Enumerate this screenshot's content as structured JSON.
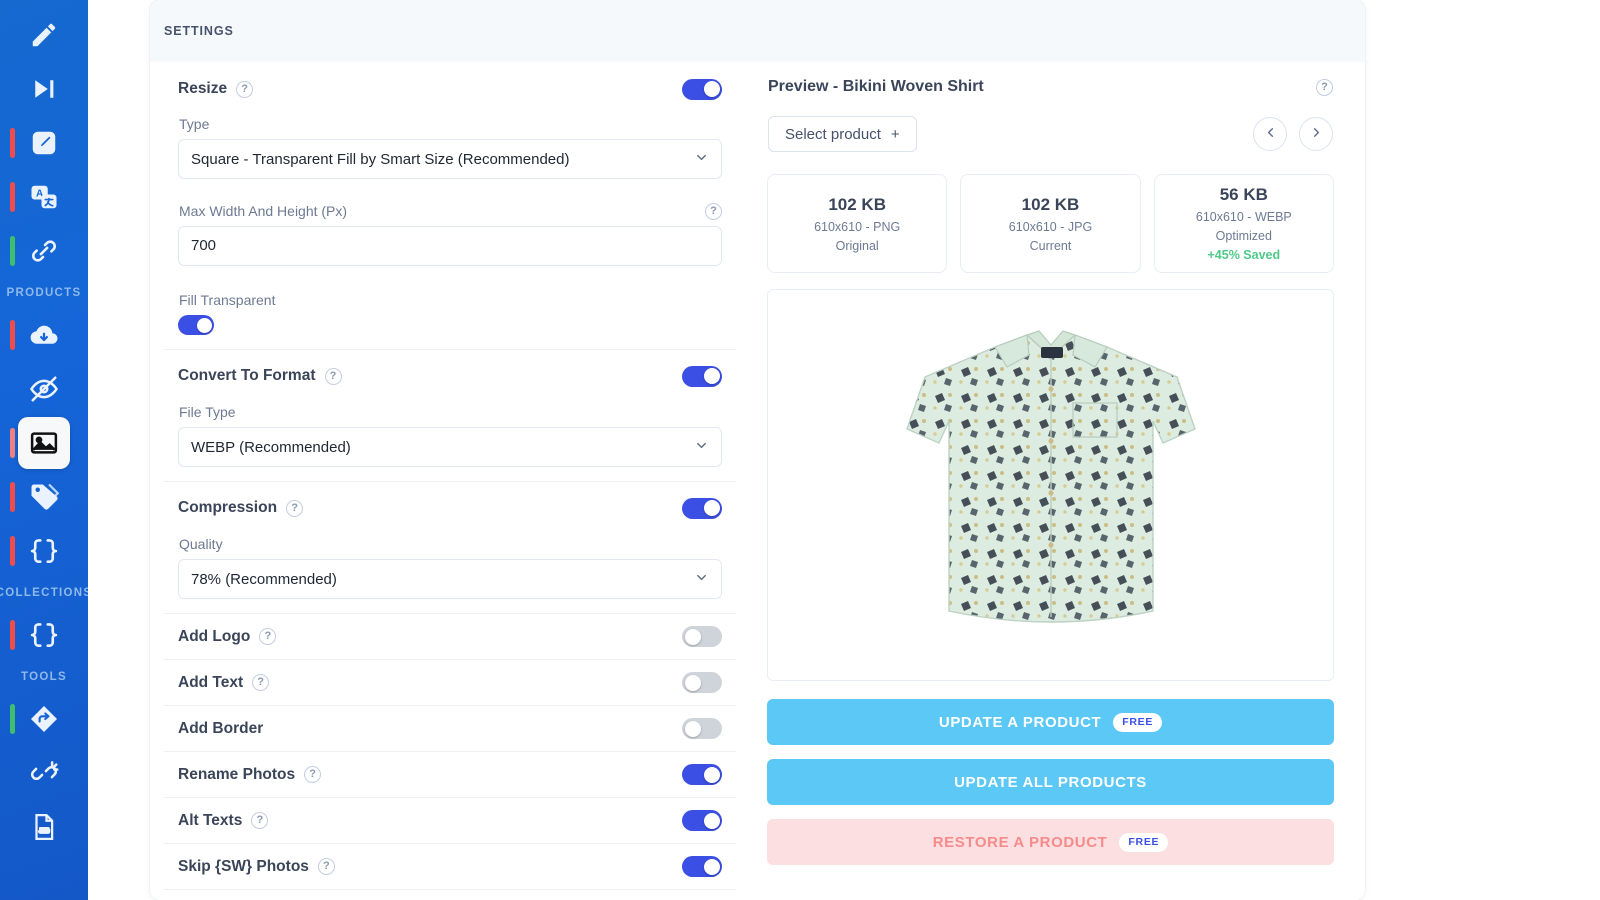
{
  "sidebar": {
    "items": [
      {
        "icon": "pencil-icon",
        "bar": "none",
        "active": false
      },
      {
        "icon": "skip-next-icon",
        "bar": "none",
        "active": false
      },
      {
        "icon": "edit-square-icon",
        "bar": "#ef4d4d",
        "active": false
      },
      {
        "icon": "translate-icon",
        "bar": "#ef4d4d",
        "active": false
      },
      {
        "icon": "link-icon",
        "bar": "#3fbf6e",
        "active": false
      },
      {
        "section": "PRODUCTS"
      },
      {
        "icon": "cloud-download-icon",
        "bar": "#ef4d4d",
        "active": false
      },
      {
        "icon": "eye-off-icon",
        "bar": "none",
        "active": false
      },
      {
        "icon": "image-icon",
        "bar": "#f08080",
        "active": true
      },
      {
        "icon": "tag-icon",
        "bar": "#ef4d4d",
        "active": false
      },
      {
        "icon": "braces-icon",
        "bar": "#ef4d4d",
        "active": false
      },
      {
        "section": "COLLECTIONS"
      },
      {
        "icon": "braces-icon",
        "bar": "#ef4d4d",
        "active": false
      },
      {
        "section": "TOOLS"
      },
      {
        "icon": "redirect-icon",
        "bar": "#3fbf6e",
        "active": false
      },
      {
        "icon": "broken-link-icon",
        "bar": "none",
        "active": false
      },
      {
        "icon": "jpg-file-icon",
        "bar": "none",
        "active": false
      }
    ]
  },
  "panel": {
    "header_title": "SETTINGS"
  },
  "settings": {
    "resize": {
      "label": "Resize",
      "help": "?",
      "toggle": "on",
      "type_label": "Type",
      "type_value": "Square - Transparent Fill by Smart Size (Recommended)",
      "maxwh_label": "Max Width And Height (Px)",
      "maxwh_help": "?",
      "maxwh_value": "700",
      "fill_label": "Fill Transparent",
      "fill_toggle": "on"
    },
    "convert": {
      "label": "Convert To Format",
      "help": "?",
      "toggle": "on",
      "filetype_label": "File Type",
      "filetype_value": "WEBP (Recommended)"
    },
    "compression": {
      "label": "Compression",
      "help": "?",
      "toggle": "on",
      "quality_label": "Quality",
      "quality_value": "78% (Recommended)"
    },
    "simple_rows": [
      {
        "label": "Add Logo",
        "help": "?",
        "toggle": "off"
      },
      {
        "label": "Add Text",
        "help": "?",
        "toggle": "off"
      },
      {
        "label": "Add Border",
        "help": "",
        "toggle": "off"
      },
      {
        "label": "Rename Photos",
        "help": "?",
        "toggle": "on"
      },
      {
        "label": "Alt Texts",
        "help": "?",
        "toggle": "on"
      },
      {
        "label": "Skip {SW} Photos",
        "help": "?",
        "toggle": "on"
      }
    ]
  },
  "preview": {
    "title": "Preview - Bikini Woven Shirt",
    "help": "?",
    "select_product_label": "Select product",
    "select_product_plus": "+",
    "prev_arrow": "‹",
    "next_arrow": "›",
    "stats": [
      {
        "size": "102 KB",
        "dimensions": "610x610 - PNG",
        "state": "Original",
        "saved": ""
      },
      {
        "size": "102 KB",
        "dimensions": "610x610 - JPG",
        "state": "Current",
        "saved": ""
      },
      {
        "size": "56 KB",
        "dimensions": "610x610 - WEBP",
        "state": "Optimized",
        "saved": "+45% Saved"
      }
    ],
    "product_image_alt": "Mint green patterned short sleeve button up shirt"
  },
  "actions": [
    {
      "label": "Update A Product",
      "badge": "FREE",
      "style": "primary"
    },
    {
      "label": "Update All Products",
      "badge": "",
      "style": "primary"
    },
    {
      "label": "Restore A Product",
      "badge": "FREE",
      "style": "danger"
    }
  ],
  "colors": {
    "sidebar_blue": "#1565d8",
    "toggle_on": "#3b4fe4",
    "toggle_off": "#cfd4da",
    "primary_button": "#5cc8f5",
    "danger_button_bg": "#fcdfe0",
    "danger_button_text": "#f78b8b",
    "saved_green": "#4fc98a",
    "badge_text": "#3b4fe4"
  }
}
